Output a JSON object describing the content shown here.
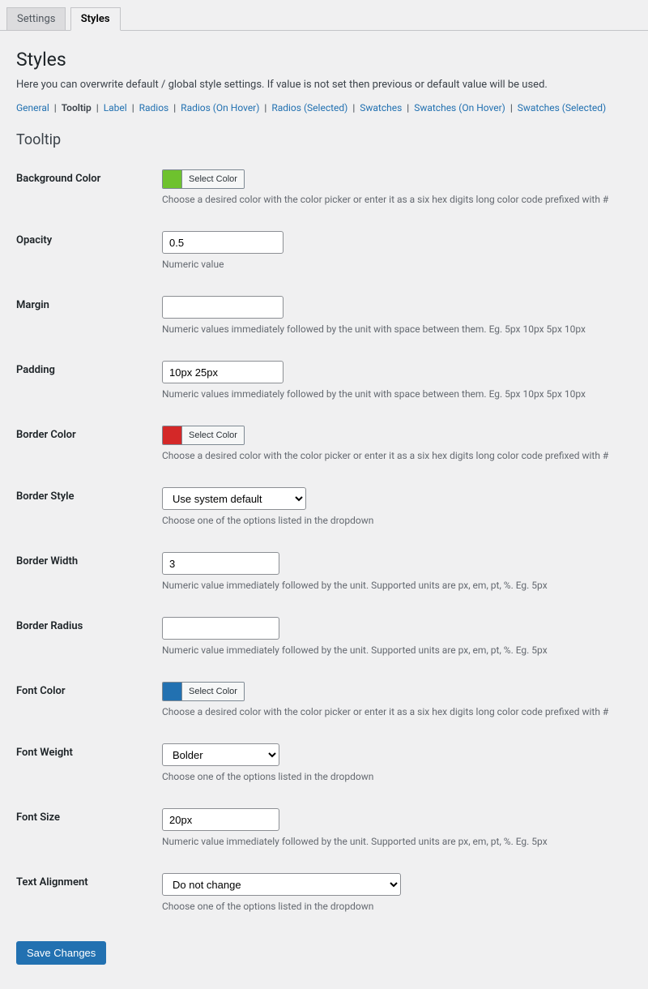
{
  "tabs": {
    "settings": "Settings",
    "styles": "Styles"
  },
  "page": {
    "title": "Styles",
    "description": "Here you can overwrite default / global style settings. If value is not set then previous or default value will be used."
  },
  "subnav": {
    "general": "General",
    "tooltip": "Tooltip",
    "label": "Label",
    "radios": "Radios",
    "radios_hover": "Radios (On Hover)",
    "radios_selected": "Radios (Selected)",
    "swatches": "Swatches",
    "swatches_hover": "Swatches (On Hover)",
    "swatches_selected": "Swatches (Selected)"
  },
  "section": {
    "heading": "Tooltip"
  },
  "fields": {
    "bg_color": {
      "label": "Background Color",
      "button": "Select Color",
      "swatch": "#6ec22e",
      "help": "Choose a desired color with the color picker or enter it as a six hex digits long color code prefixed with #"
    },
    "opacity": {
      "label": "Opacity",
      "value": "0.5",
      "help": "Numeric value"
    },
    "margin": {
      "label": "Margin",
      "value": "",
      "help": "Numeric values immediately followed by the unit with space between them. Eg. 5px 10px 5px 10px"
    },
    "padding": {
      "label": "Padding",
      "value": "10px 25px",
      "help": "Numeric values immediately followed by the unit with space between them. Eg. 5px 10px 5px 10px"
    },
    "border_color": {
      "label": "Border Color",
      "button": "Select Color",
      "swatch": "#d42828",
      "help": "Choose a desired color with the color picker or enter it as a six hex digits long color code prefixed with #"
    },
    "border_style": {
      "label": "Border Style",
      "selected": "Use system default",
      "help": "Choose one of the options listed in the dropdown"
    },
    "border_width": {
      "label": "Border Width",
      "value": "3",
      "help": "Numeric value immediately followed by the unit. Supported units are px, em, pt, %. Eg. 5px"
    },
    "border_radius": {
      "label": "Border Radius",
      "value": "",
      "help": "Numeric value immediately followed by the unit. Supported units are px, em, pt, %. Eg. 5px"
    },
    "font_color": {
      "label": "Font Color",
      "button": "Select Color",
      "swatch": "#2271b1",
      "help": "Choose a desired color with the color picker or enter it as a six hex digits long color code prefixed with #"
    },
    "font_weight": {
      "label": "Font Weight",
      "selected": "Bolder",
      "help": "Choose one of the options listed in the dropdown"
    },
    "font_size": {
      "label": "Font Size",
      "value": "20px",
      "help": "Numeric value immediately followed by the unit. Supported units are px, em, pt, %. Eg. 5px"
    },
    "text_align": {
      "label": "Text Alignment",
      "selected": "Do not change",
      "help": "Choose one of the options listed in the dropdown"
    }
  },
  "submit": {
    "label": "Save Changes"
  }
}
